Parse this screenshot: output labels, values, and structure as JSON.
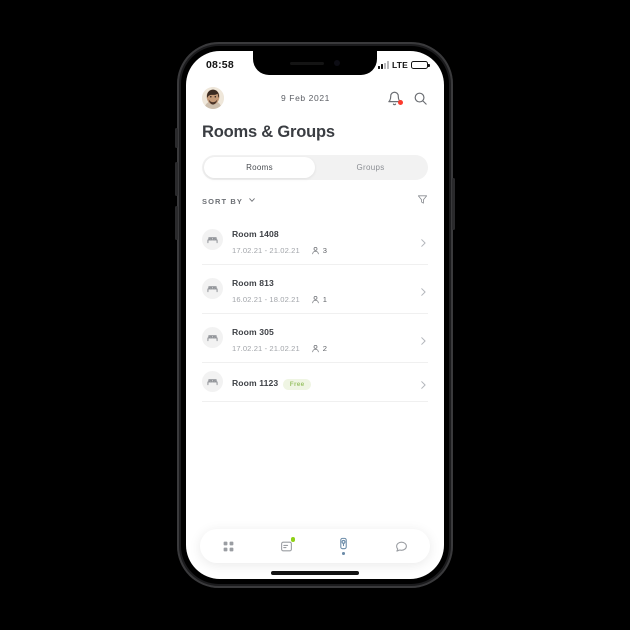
{
  "status_bar": {
    "time": "08:58",
    "network": "LTE",
    "signal_icon": "signal-bars-icon",
    "battery_icon": "battery-full-icon"
  },
  "header": {
    "avatar_icon": "user-avatar",
    "date": "9 Feb 2021",
    "bell_icon": "bell-icon",
    "bell_has_notification": true,
    "search_icon": "search-icon"
  },
  "page": {
    "title": "Rooms & Groups"
  },
  "segmented": {
    "options": [
      {
        "label": "Rooms",
        "active": true
      },
      {
        "label": "Groups",
        "active": false
      }
    ]
  },
  "sort": {
    "label": "SORT BY",
    "chevron_icon": "chevron-down-icon",
    "filter_icon": "filter-funnel-icon"
  },
  "rooms": [
    {
      "name": "Room 1408",
      "dates": "17.02.21 - 21.02.21",
      "guests": "3",
      "status": null,
      "icon": "bed-icon"
    },
    {
      "name": "Room 813",
      "dates": "16.02.21 - 18.02.21",
      "guests": "1",
      "status": null,
      "icon": "bed-icon"
    },
    {
      "name": "Room 305",
      "dates": "17.02.21 - 21.02.21",
      "guests": "2",
      "status": null,
      "icon": "bed-icon"
    },
    {
      "name": "Room 1123",
      "dates": null,
      "guests": null,
      "status": "Free",
      "icon": "bed-icon"
    }
  ],
  "tab_bar": {
    "items": [
      {
        "name": "grid-icon",
        "active": false,
        "badge": false
      },
      {
        "name": "bookings-card-icon",
        "active": false,
        "badge": true
      },
      {
        "name": "key-card-icon",
        "active": true,
        "badge": false
      },
      {
        "name": "chat-bubble-icon",
        "active": false,
        "badge": false
      }
    ]
  },
  "colors": {
    "accent_green": "#8fd117",
    "badge_green_text": "#9cc46a",
    "badge_green_bg": "#eff5e3",
    "notification_red": "#fc3a2d",
    "active_tab_blue": "#6b8ba8",
    "text_dark": "#3e4146",
    "text_muted": "#a2a5aa"
  }
}
